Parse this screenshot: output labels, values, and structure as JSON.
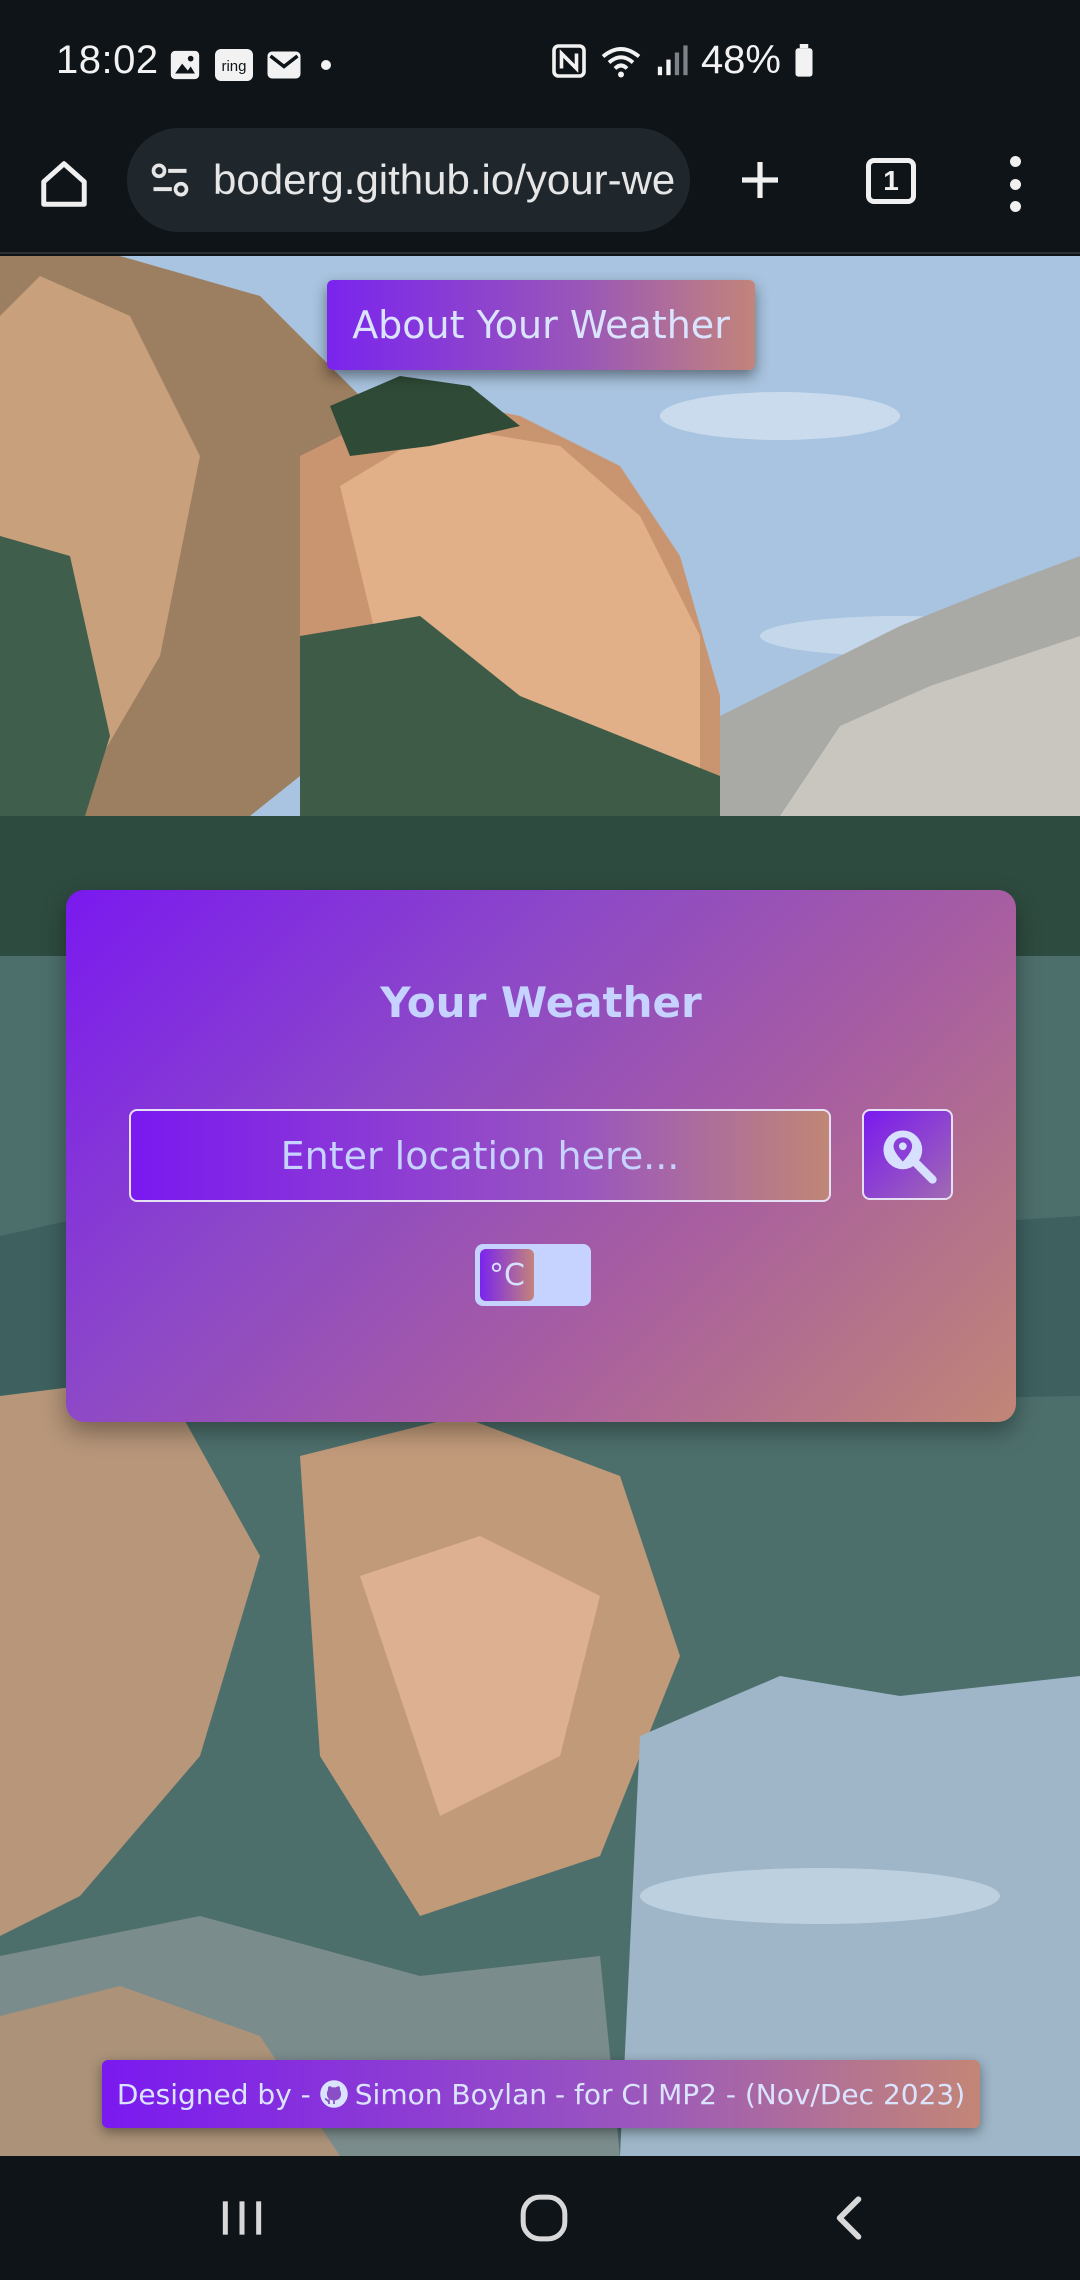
{
  "status_bar": {
    "time": "18:02",
    "notification_icons": [
      "gallery-icon",
      "ring-icon",
      "mail-icon",
      "dot-icon"
    ],
    "ring_label": "ring",
    "system_icons": [
      "nfc-icon",
      "wifi-icon",
      "signal-icon",
      "battery-icon"
    ],
    "battery": "48%"
  },
  "browser": {
    "url": "boderg.github.io/your-we",
    "tab_count": "1"
  },
  "page": {
    "about_button": "About Your Weather",
    "card": {
      "title": "Your Weather",
      "input_placeholder": "Enter location here...",
      "unit_toggle": "°C"
    },
    "footer": {
      "prefix": "Designed by -",
      "author_link": "Simon Boylan",
      "suffix": "- for CI MP2 - (Nov/Dec 2023)"
    }
  },
  "colors": {
    "accent_purple": "#7a19f0",
    "accent_rose": "#c18676",
    "text_lavender": "#c6d2ff"
  }
}
